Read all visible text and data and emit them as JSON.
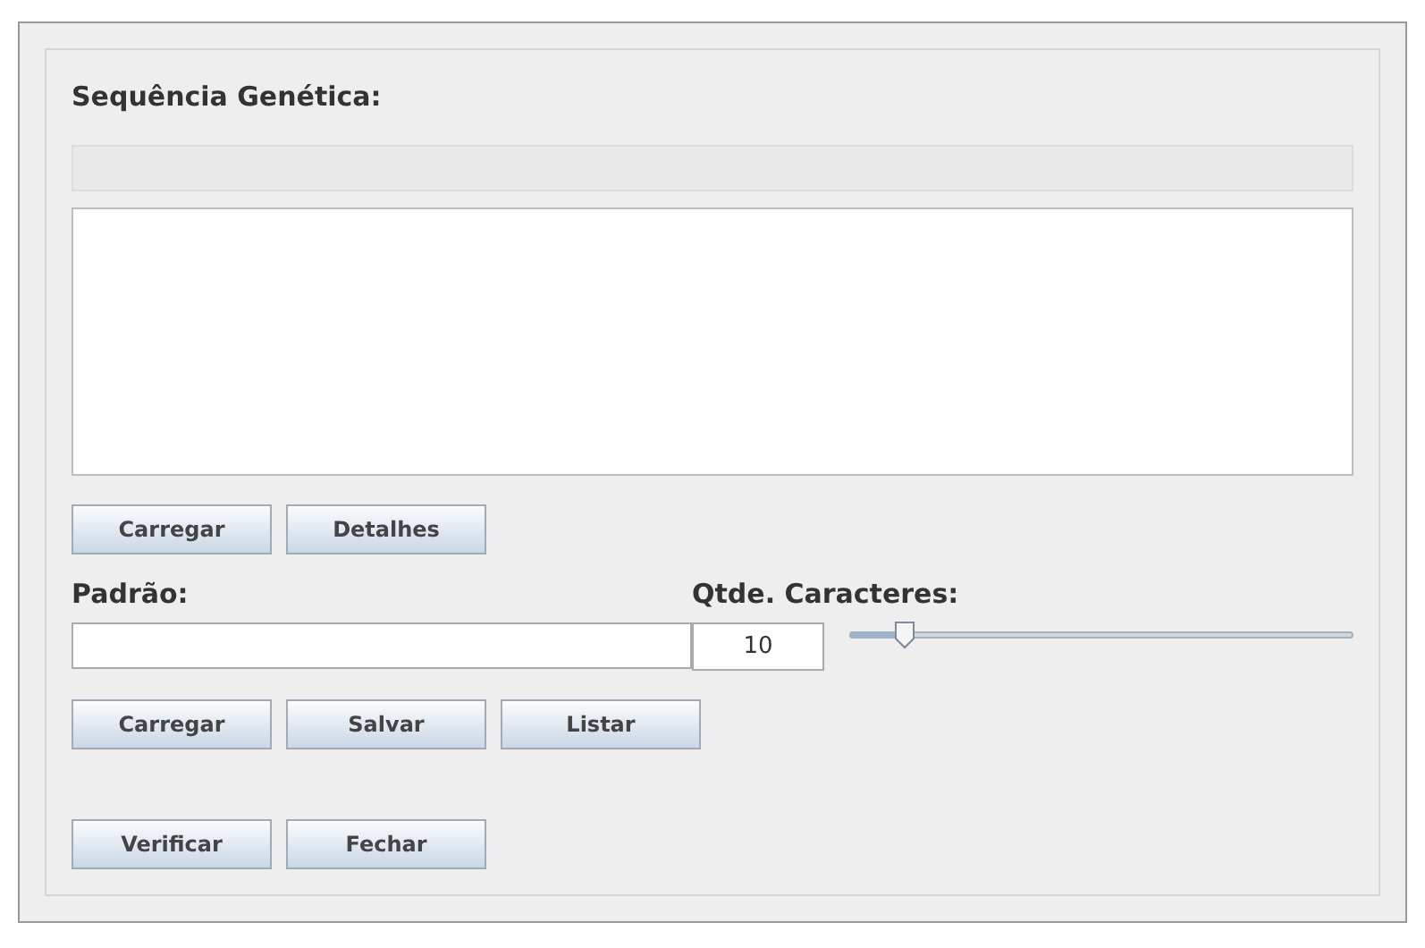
{
  "title": "Sequência Genética:",
  "sequence_buttons": [
    "Carregar",
    "Detalhes"
  ],
  "pattern": {
    "label": "Padrão:"
  },
  "char_count": {
    "label": "Qtde. Caracteres:",
    "value": "10",
    "level": 0.11
  },
  "pattern_buttons": [
    "Carregar",
    "Salvar",
    "Listar"
  ],
  "action_buttons": [
    "Verificar",
    "Fechar"
  ]
}
